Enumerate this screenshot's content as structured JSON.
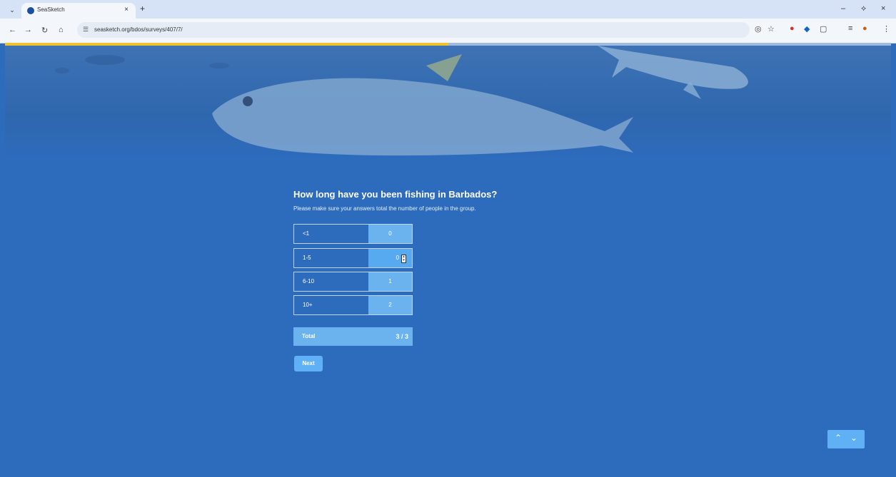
{
  "browser": {
    "tab_title": "SeaSketch",
    "new_tab": "+",
    "tab_close": "×",
    "url": "seasketch.org/bdos/surveys/407/7/",
    "win_min": "–",
    "win_restore": "⟡",
    "win_close": "×"
  },
  "survey": {
    "progress": 0.5,
    "question": "How long have you been fishing in Barbados?",
    "subtitle": "Please make sure your answers total the number of people in the group.",
    "rows": [
      {
        "label": "<1",
        "value": "0"
      },
      {
        "label": "1-5",
        "value": "0"
      },
      {
        "label": "6-10",
        "value": "1"
      },
      {
        "label": "10+",
        "value": "2"
      }
    ],
    "total_label": "Total",
    "total_value": "3 / 3",
    "next_label": "Next"
  }
}
